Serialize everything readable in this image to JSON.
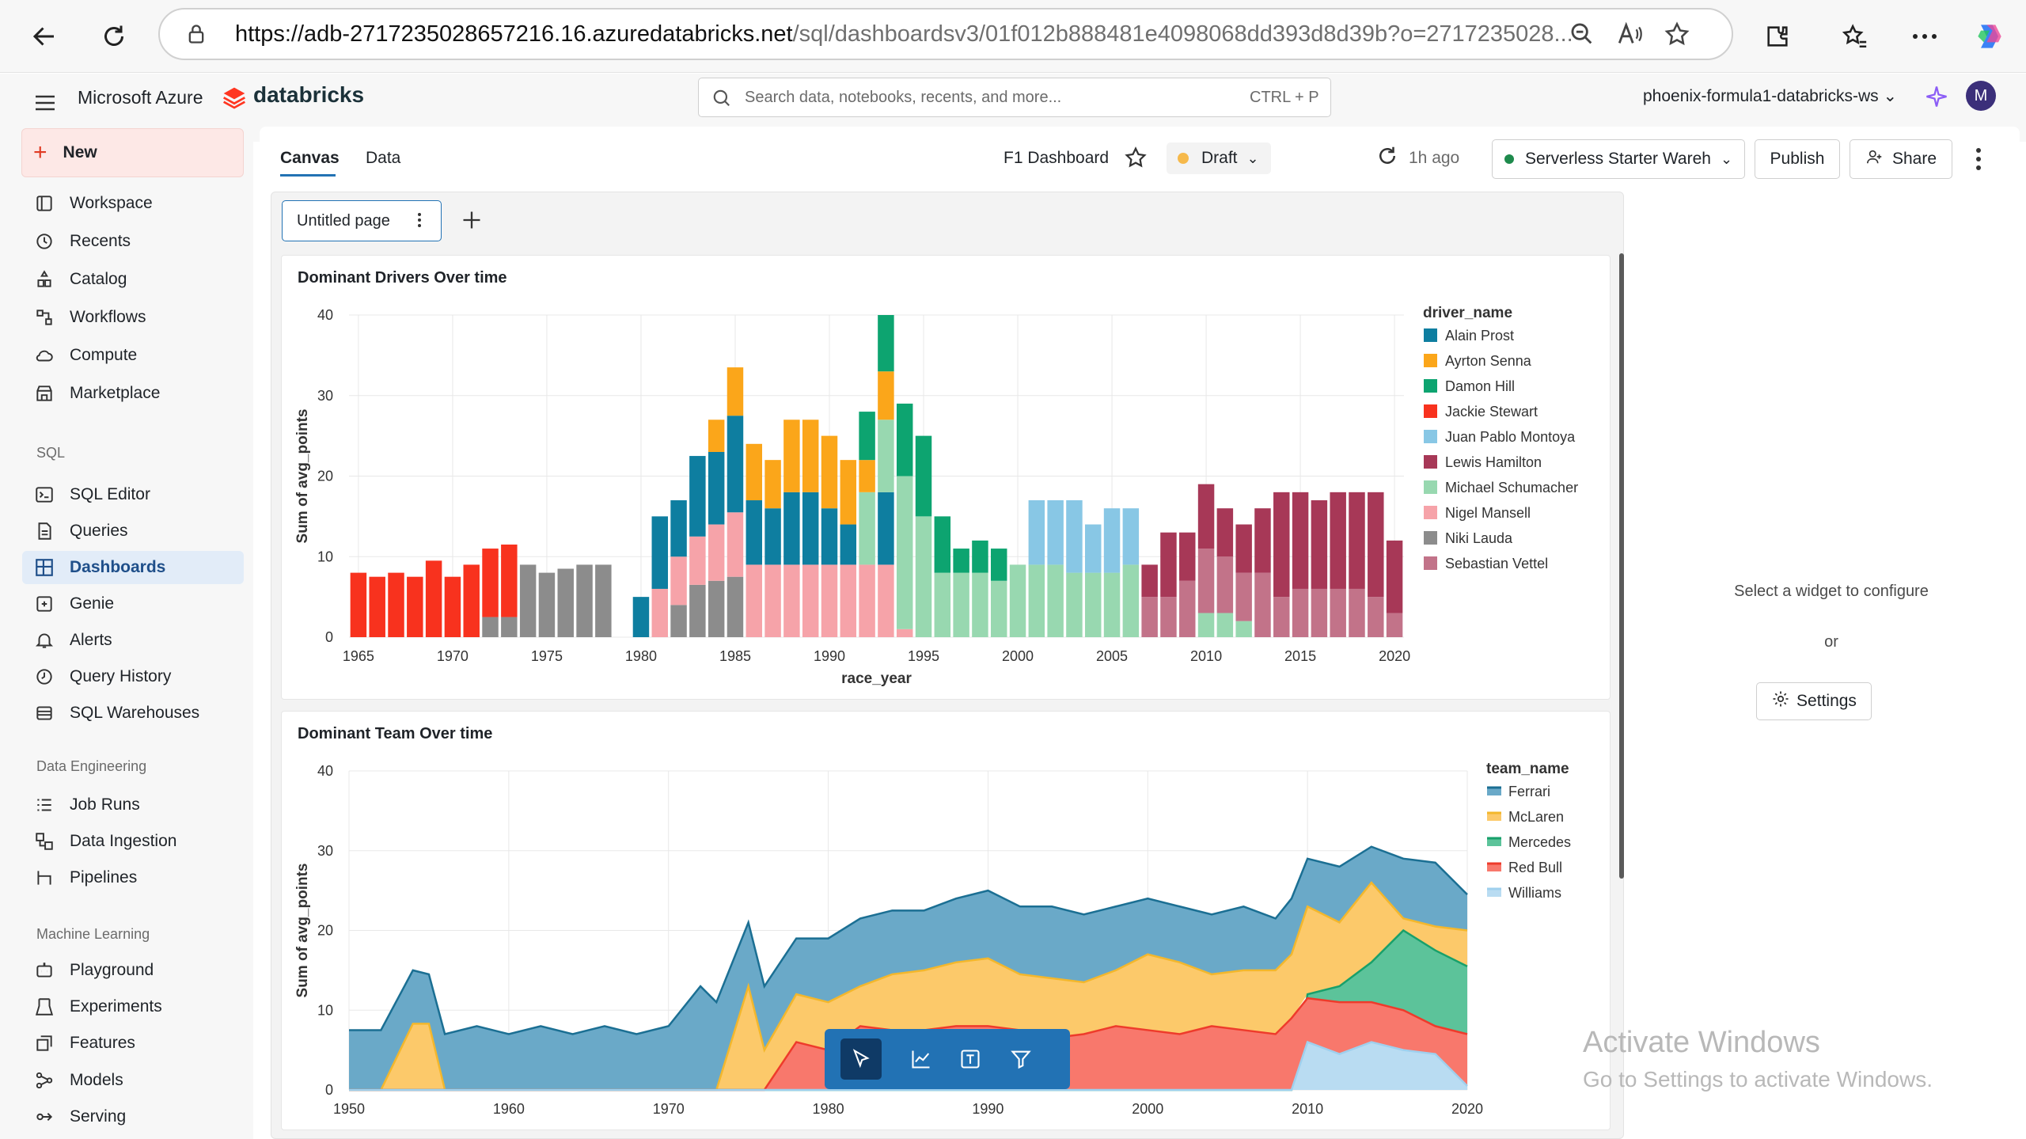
{
  "browser": {
    "url_host": "https://adb-2717235028657216.16.azuredatabricks.net",
    "url_path": "/sql/dashboardsv3/01f012b888481e4098068dd393d8d39b?o=2717235028..."
  },
  "app": {
    "brand_azure": "Microsoft Azure",
    "brand_databricks": "databricks",
    "search_placeholder": "Search data, notebooks, recents, and more...",
    "search_shortcut": "CTRL + P",
    "workspace_name": "phoenix-formula1-databricks-ws",
    "avatar_initial": "M"
  },
  "sidebar": {
    "new_label": "New",
    "items_top": [
      {
        "label": "Workspace",
        "icon": "folder-icon"
      },
      {
        "label": "Recents",
        "icon": "clock-icon"
      },
      {
        "label": "Catalog",
        "icon": "catalog-icon"
      },
      {
        "label": "Workflows",
        "icon": "workflows-icon"
      },
      {
        "label": "Compute",
        "icon": "cloud-icon"
      },
      {
        "label": "Marketplace",
        "icon": "store-icon"
      }
    ],
    "section_sql": "SQL",
    "items_sql": [
      {
        "label": "SQL Editor",
        "icon": "editor-icon"
      },
      {
        "label": "Queries",
        "icon": "queries-icon"
      },
      {
        "label": "Dashboards",
        "icon": "dashboard-icon"
      },
      {
        "label": "Genie",
        "icon": "genie-icon"
      },
      {
        "label": "Alerts",
        "icon": "bell-icon"
      },
      {
        "label": "Query History",
        "icon": "history-icon"
      },
      {
        "label": "SQL Warehouses",
        "icon": "warehouse-icon"
      }
    ],
    "section_de": "Data Engineering",
    "items_de": [
      {
        "label": "Job Runs",
        "icon": "list-icon"
      },
      {
        "label": "Data Ingestion",
        "icon": "ingestion-icon"
      },
      {
        "label": "Pipelines",
        "icon": "pipeline-icon"
      }
    ],
    "section_ml": "Machine Learning",
    "items_ml": [
      {
        "label": "Playground",
        "icon": "robot-icon"
      },
      {
        "label": "Experiments",
        "icon": "flask-icon"
      },
      {
        "label": "Features",
        "icon": "features-icon"
      },
      {
        "label": "Models",
        "icon": "models-icon"
      },
      {
        "label": "Serving",
        "icon": "serving-icon"
      }
    ]
  },
  "toolbar": {
    "tab_canvas": "Canvas",
    "tab_data": "Data",
    "dashboard_title": "F1 Dashboard",
    "status": "Draft",
    "refreshed": "1h ago",
    "warehouse": "Serverless Starter Wareh",
    "publish": "Publish",
    "share": "Share"
  },
  "page_tab": {
    "label": "Untitled page"
  },
  "config_panel": {
    "message": "Select a widget to configure",
    "or": "or",
    "settings": "Settings"
  },
  "watermark": {
    "line1": "Activate Windows",
    "line2": "Go to Settings to activate Windows."
  },
  "colors": {
    "accent": "#2272b4",
    "active_nav_bg": "#e2ecf8",
    "new_button_bg": "#fde8e6",
    "draft_dot": "#f6b94b",
    "warehouse_dot": "#1e8a4c"
  },
  "chart_data": [
    {
      "type": "bar",
      "title": "Dominant Drivers Over time",
      "xlabel": "race_year",
      "ylabel": "Sum of avg_points",
      "ylim": [
        0,
        40
      ],
      "yticks": [
        0,
        10,
        20,
        30,
        40
      ],
      "xticks": [
        1965,
        1970,
        1975,
        1980,
        1985,
        1990,
        1995,
        2000,
        2005,
        2010,
        2015,
        2020
      ],
      "legend_title": "driver_name",
      "legend_position": "right",
      "stacked": true,
      "series": [
        {
          "name": "Alain Prost",
          "color": "#0e7ea0",
          "values": {
            "1980": 5,
            "1981": 9,
            "1982": 7,
            "1983": 10,
            "1984": 9,
            "1985": 12,
            "1986": 8,
            "1987": 7,
            "1988": 9,
            "1989": 9,
            "1990": 7,
            "1991": 5,
            "1993": 9
          }
        },
        {
          "name": "Ayrton Senna",
          "color": "#fba61a",
          "values": {
            "1984": 4,
            "1985": 6,
            "1986": 7,
            "1987": 6,
            "1988": 9,
            "1989": 9,
            "1990": 9,
            "1991": 8,
            "1992": 4,
            "1993": 6
          }
        },
        {
          "name": "Damon Hill",
          "color": "#0da470",
          "values": {
            "1992": 6,
            "1993": 7,
            "1994": 9,
            "1995": 10,
            "1996": 7,
            "1997": 3,
            "1998": 4,
            "1999": 4
          }
        },
        {
          "name": "Jackie Stewart",
          "color": "#f8321e",
          "values": {
            "1965": 8,
            "1966": 7.5,
            "1967": 8,
            "1968": 7.5,
            "1969": 9.5,
            "1970": 7.5,
            "1971": 9,
            "1972": 8.5,
            "1973": 9
          }
        },
        {
          "name": "Juan Pablo Montoya",
          "color": "#88c7e5",
          "values": {
            "2001": 8,
            "2002": 8,
            "2003": 9,
            "2004": 6,
            "2005": 8,
            "2006": 7
          }
        },
        {
          "name": "Lewis Hamilton",
          "color": "#a73857",
          "values": {
            "2007": 4,
            "2008": 8,
            "2009": 6,
            "2010": 8,
            "2011": 6,
            "2012": 6,
            "2013": 8,
            "2014": 13,
            "2015": 12,
            "2016": 11,
            "2017": 12,
            "2018": 12,
            "2019": 13,
            "2020": 9
          }
        },
        {
          "name": "Michael Schumacher",
          "color": "#98d8b0",
          "values": {
            "1992": 9,
            "1993": 9,
            "1994": 19,
            "1995": 15,
            "1996": 8,
            "1997": 8,
            "1998": 8,
            "1999": 7,
            "2000": 9,
            "2001": 9,
            "2002": 9,
            "2003": 8,
            "2004": 8,
            "2005": 8,
            "2006": 9,
            "2010": 3,
            "2011": 3,
            "2012": 2
          }
        },
        {
          "name": "Nigel Mansell",
          "color": "#f6a3a9",
          "values": {
            "1981": 6,
            "1982": 6,
            "1983": 6,
            "1984": 7,
            "1985": 8,
            "1986": 9,
            "1987": 9,
            "1988": 9,
            "1989": 9,
            "1990": 9,
            "1991": 9,
            "1992": 9,
            "1993": 9,
            "1994": 1
          }
        },
        {
          "name": "Niki Lauda",
          "color": "#8c8c8c",
          "values": {
            "1972": 2.5,
            "1973": 2.5,
            "1974": 9,
            "1975": 8,
            "1976": 8.5,
            "1977": 9,
            "1978": 9,
            "1982": 4,
            "1983": 6.5,
            "1984": 7,
            "1985": 7.5
          }
        },
        {
          "name": "Sebastian Vettel",
          "color": "#c27389",
          "values": {
            "2007": 5,
            "2008": 5,
            "2009": 7,
            "2010": 8,
            "2011": 7,
            "2012": 6,
            "2013": 8,
            "2014": 5,
            "2015": 6,
            "2016": 6,
            "2017": 6,
            "2018": 6,
            "2019": 5,
            "2020": 3
          }
        }
      ]
    },
    {
      "type": "area",
      "title": "Dominant Team Over time",
      "ylabel": "Sum of avg_points",
      "ylim": [
        0,
        40
      ],
      "yticks": [
        0,
        10,
        20,
        30,
        40
      ],
      "xticks": [
        1950,
        1960,
        1970,
        1980,
        1990,
        2000,
        2010,
        2020
      ],
      "legend_title": "team_name",
      "legend_position": "right",
      "stacked": true,
      "x": [
        1950,
        1951,
        1952,
        1953,
        1954,
        1955,
        1956,
        1957,
        1958,
        1959,
        1960,
        1961,
        1962,
        1963,
        1964,
        1965,
        1966,
        1967,
        1968,
        1969,
        1970,
        1971,
        1972,
        1973,
        1974,
        1975,
        1976,
        1977,
        1978,
        1979,
        1980,
        1981,
        1982,
        1983,
        1984,
        1985,
        1986,
        1987,
        1988,
        1989,
        1990,
        1991,
        1992,
        1993,
        1994,
        1995,
        1996,
        1997,
        1998,
        1999,
        2000,
        2001,
        2002,
        2003,
        2004,
        2005,
        2006,
        2007,
        2008,
        2009,
        2010,
        2011,
        2012,
        2013,
        2014,
        2015,
        2016,
        2017,
        2018,
        2019,
        2020
      ],
      "series": [
        {
          "name": "Williams",
          "color": "#b9dcf2",
          "values": [
            0,
            0,
            0,
            0,
            0,
            0,
            0,
            0,
            0,
            0,
            0,
            0,
            0,
            0,
            0,
            0,
            0,
            0,
            0,
            0,
            0,
            0,
            0,
            0,
            0,
            0,
            0,
            0,
            0,
            0,
            0,
            0,
            0,
            0,
            0,
            0,
            0,
            0,
            0,
            0,
            0,
            0,
            0,
            0,
            0,
            0,
            0,
            0,
            0,
            0,
            0,
            0,
            0,
            0,
            0,
            0,
            0,
            0,
            0,
            0,
            0,
            0,
            0,
            0,
            0,
            0,
            0,
            0,
            0,
            0,
            0
          ]
        },
        {
          "name": "Red Bull",
          "color": "#f8786c",
          "values": [
            0,
            0,
            0,
            0,
            0,
            0,
            0,
            0,
            0,
            0,
            0,
            0,
            0,
            0,
            0,
            0,
            0,
            0,
            0,
            0,
            0,
            0,
            0,
            0,
            0,
            0,
            0,
            0,
            0,
            0,
            0,
            0,
            0,
            0,
            0,
            0,
            0,
            0,
            0,
            0,
            0,
            0,
            0,
            0,
            0,
            0,
            0,
            0,
            0,
            0,
            0,
            0,
            0,
            0,
            0,
            0,
            0,
            0,
            0,
            0,
            0,
            0,
            0,
            0,
            0,
            0,
            0,
            0,
            0,
            0,
            0
          ]
        },
        {
          "name": "Mercedes",
          "color": "#5cc39a",
          "values": [
            0,
            0,
            0,
            0,
            0,
            0,
            0,
            0,
            0,
            0,
            0,
            0,
            0,
            0,
            0,
            0,
            0,
            0,
            0,
            0,
            0,
            0,
            0,
            0,
            0,
            0,
            0,
            0,
            0,
            0,
            0,
            0,
            0,
            0,
            0,
            0,
            0,
            0,
            0,
            0,
            0,
            0,
            0,
            0,
            0,
            0,
            0,
            0,
            0,
            0,
            0,
            0,
            0,
            0,
            0,
            0,
            0,
            0,
            0,
            0,
            0,
            0,
            0,
            0,
            0,
            0,
            0,
            0,
            0,
            0,
            0
          ]
        },
        {
          "name": "McLaren",
          "color": "#fcc96a",
          "values": [
            0,
            0,
            0,
            0,
            4.3,
            8.3,
            0,
            0,
            0,
            0,
            0,
            0,
            0,
            0,
            0,
            0,
            0,
            0,
            0,
            0,
            0,
            0,
            0,
            0,
            0,
            0,
            0,
            0,
            0,
            0,
            0,
            0,
            0,
            0,
            0,
            0,
            0,
            0,
            0,
            0,
            0,
            0,
            0,
            0,
            0,
            0,
            0,
            0,
            0,
            0,
            0,
            0,
            0,
            0,
            0,
            0,
            0,
            0,
            0,
            0,
            0,
            0,
            0,
            0,
            0,
            0,
            0,
            0,
            0,
            0,
            0
          ]
        },
        {
          "name": "Ferrari",
          "color": "#6aa9c8",
          "values": [
            7.5,
            8,
            7.5,
            7,
            10.7,
            6.7,
            7,
            7.5,
            8,
            8,
            7,
            7.5,
            8,
            7,
            7,
            7.5,
            8,
            7.5,
            7,
            7.5,
            8,
            10,
            13,
            11,
            12,
            13,
            9,
            14,
            13,
            12,
            13,
            14,
            13.5,
            13.5,
            14,
            13,
            13.5,
            14.5,
            14.5,
            14,
            14.5,
            13,
            12.5,
            12,
            12.5,
            12,
            11,
            10.5,
            11,
            12,
            12,
            11,
            11.5,
            11,
            12,
            12,
            11,
            11,
            10.5,
            12.5,
            10.5,
            8,
            7.5,
            6,
            5.5,
            5,
            4.5,
            4.5,
            4.5,
            4.5,
            4.5
          ]
        }
      ],
      "stack_totals": {
        "x": [
          1950,
          1952,
          1954,
          1955,
          1956,
          1958,
          1960,
          1962,
          1964,
          1966,
          1968,
          1970,
          1972,
          1973,
          1975,
          1976,
          1978,
          1980,
          1982,
          1984,
          1986,
          1988,
          1990,
          1992,
          1994,
          1996,
          1998,
          2000,
          2002,
          2004,
          2006,
          2008,
          2009,
          2010,
          2012,
          2014,
          2016,
          2018,
          2020
        ],
        "ferrari_top": [
          7.5,
          7.5,
          15,
          14.5,
          7,
          8,
          7,
          8,
          7,
          8,
          7,
          8,
          13,
          11,
          21,
          13,
          19,
          19,
          21.5,
          22.5,
          22.5,
          24,
          25,
          23,
          23,
          22,
          23,
          24,
          23,
          22,
          23,
          21.5,
          24,
          29,
          28,
          30.5,
          29,
          28.5,
          24.5
        ],
        "mclaren_top": [
          0,
          0,
          8.3,
          8.3,
          0,
          0,
          0,
          0,
          0,
          0,
          0,
          0,
          0,
          0,
          13,
          5,
          12,
          11,
          13,
          14.5,
          15,
          16,
          16.5,
          14.5,
          14,
          13.5,
          15,
          17,
          16,
          14.5,
          15,
          15,
          17,
          23,
          21,
          26,
          21.5,
          20.5,
          20
        ],
        "mercedes_top": [
          0,
          0,
          0,
          0,
          0,
          0,
          0,
          0,
          0,
          0,
          0,
          0,
          0,
          0,
          0,
          0,
          0,
          0,
          0,
          0,
          0,
          0,
          0,
          0,
          0,
          0,
          0,
          0,
          0,
          0,
          0,
          0,
          0,
          12,
          13,
          16,
          20,
          17.5,
          15.5
        ],
        "redbull_top": [
          0,
          0,
          0,
          0,
          0,
          0,
          0,
          0,
          0,
          0,
          0,
          0,
          0,
          0,
          0,
          0,
          6,
          5,
          8,
          7.5,
          7.5,
          8,
          8,
          7.5,
          6.5,
          7,
          8,
          7.5,
          7,
          8,
          7.5,
          7,
          9,
          11.5,
          11,
          11,
          10,
          8,
          7
        ],
        "williams_top": [
          0,
          0,
          0,
          0,
          0,
          0,
          0,
          0,
          0,
          0,
          0,
          0,
          0,
          0,
          0,
          0,
          0,
          0,
          0,
          0,
          0,
          0,
          0,
          0,
          0,
          0,
          0,
          0,
          0,
          0,
          0,
          0,
          0,
          6,
          4.5,
          6,
          5,
          4.5,
          0.5
        ]
      }
    }
  ]
}
